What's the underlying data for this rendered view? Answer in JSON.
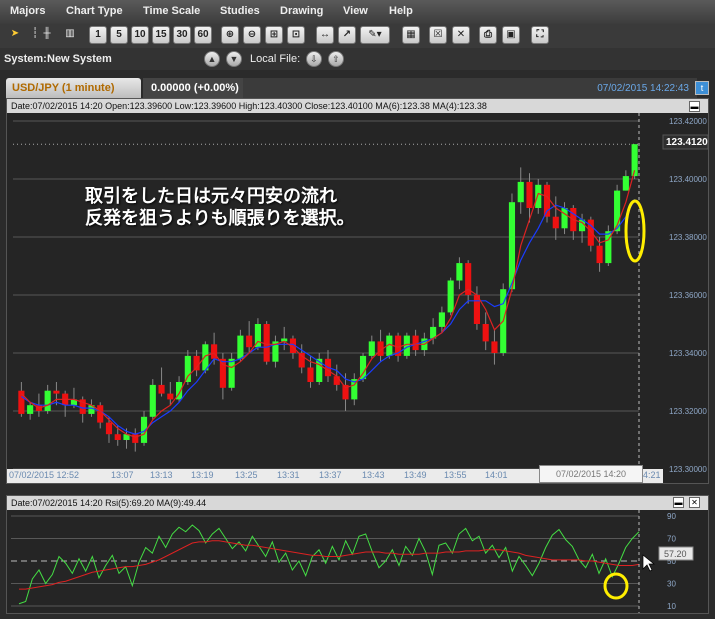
{
  "menu": [
    "Majors",
    "Chart Type",
    "Time Scale",
    "Studies",
    "Drawing",
    "View",
    "Help"
  ],
  "toolbar": {
    "intervals": [
      "1",
      "5",
      "10",
      "15",
      "30",
      "60"
    ]
  },
  "system": {
    "label": "System:",
    "name": "New System",
    "local_file_label": "Local File:"
  },
  "tab": {
    "symbol": "USD/JPY (1 minute)",
    "change": "0.00000 (+0.00%)",
    "datetime": "07/02/2015 14:22:43"
  },
  "price_panel": {
    "info": "Date:07/02/2015 14:20  Open:123.39600  Low:123.39600  High:123.40300  Close:123.40100  MA(6):123.38  MA(4):123.38",
    "last_price": "123.41200",
    "y_ticks": [
      "123.42000",
      "123.40000",
      "123.38000",
      "123.36000",
      "123.34000",
      "123.32000",
      "123.30000"
    ],
    "x_first": "07/02/2015 12:52",
    "x_ticks": [
      "13:07",
      "13:13",
      "13:19",
      "13:25",
      "13:31",
      "13:37",
      "13:43",
      "13:49",
      "13:55",
      "14:01"
    ],
    "crosshair_label": "07/02/2015 14:20",
    "x_last_partial": "4:21",
    "annotation": [
      "取引をした日は元々円安の流れ",
      "反発を狙うよりも順張りを選択。"
    ]
  },
  "rsi_panel": {
    "info": "Date:07/02/2015 14:20  Rsi(5):69.20  MA(9):49.44",
    "y_ticks": [
      "90",
      "70",
      "50",
      "30",
      "10"
    ],
    "value_label": "57.20"
  },
  "colors": {
    "up": "#33ff33",
    "down": "#ee1111",
    "ma_short": "#1a3cff",
    "ma_long": "#dd2222",
    "rsi": "#44dd44",
    "highlight": "#ffee00"
  },
  "chart_data": [
    {
      "type": "candlestick",
      "title": "USD/JPY (1 minute)",
      "ylim": [
        123.3,
        123.42
      ],
      "y_ticks": [
        123.3,
        123.32,
        123.34,
        123.36,
        123.38,
        123.4,
        123.42
      ],
      "x_tick_labels": [
        "07/02/2015 12:52",
        "13:07",
        "13:13",
        "13:19",
        "13:25",
        "13:31",
        "13:37",
        "13:43",
        "13:49",
        "13:55",
        "14:01",
        "07/02/2015 14:20"
      ],
      "candles": [
        {
          "o": 123.327,
          "h": 123.33,
          "l": 123.318,
          "c": 123.319
        },
        {
          "o": 123.319,
          "h": 123.323,
          "l": 123.317,
          "c": 123.322
        },
        {
          "o": 123.322,
          "h": 123.326,
          "l": 123.318,
          "c": 123.32
        },
        {
          "o": 123.32,
          "h": 123.329,
          "l": 123.319,
          "c": 123.327
        },
        {
          "o": 123.327,
          "h": 123.33,
          "l": 123.322,
          "c": 123.326
        },
        {
          "o": 123.326,
          "h": 123.327,
          "l": 123.318,
          "c": 123.322
        },
        {
          "o": 123.322,
          "h": 123.328,
          "l": 123.321,
          "c": 123.324
        },
        {
          "o": 123.324,
          "h": 123.325,
          "l": 123.316,
          "c": 123.319
        },
        {
          "o": 123.319,
          "h": 123.324,
          "l": 123.318,
          "c": 123.322
        },
        {
          "o": 123.322,
          "h": 123.323,
          "l": 123.314,
          "c": 123.316
        },
        {
          "o": 123.316,
          "h": 123.318,
          "l": 123.309,
          "c": 123.312
        },
        {
          "o": 123.312,
          "h": 123.315,
          "l": 123.308,
          "c": 123.31
        },
        {
          "o": 123.31,
          "h": 123.314,
          "l": 123.307,
          "c": 123.312
        },
        {
          "o": 123.312,
          "h": 123.314,
          "l": 123.306,
          "c": 123.309
        },
        {
          "o": 123.309,
          "h": 123.32,
          "l": 123.308,
          "c": 123.318
        },
        {
          "o": 123.318,
          "h": 123.331,
          "l": 123.317,
          "c": 123.329
        },
        {
          "o": 123.329,
          "h": 123.335,
          "l": 123.325,
          "c": 123.326
        },
        {
          "o": 123.326,
          "h": 123.33,
          "l": 123.322,
          "c": 123.324
        },
        {
          "o": 123.324,
          "h": 123.332,
          "l": 123.323,
          "c": 123.33
        },
        {
          "o": 123.33,
          "h": 123.341,
          "l": 123.329,
          "c": 123.339
        },
        {
          "o": 123.339,
          "h": 123.341,
          "l": 123.332,
          "c": 123.334
        },
        {
          "o": 123.334,
          "h": 123.344,
          "l": 123.333,
          "c": 123.343
        },
        {
          "o": 123.343,
          "h": 123.347,
          "l": 123.336,
          "c": 123.338
        },
        {
          "o": 123.338,
          "h": 123.34,
          "l": 123.324,
          "c": 123.328
        },
        {
          "o": 123.328,
          "h": 123.34,
          "l": 123.327,
          "c": 123.338
        },
        {
          "o": 123.338,
          "h": 123.348,
          "l": 123.337,
          "c": 123.346
        },
        {
          "o": 123.346,
          "h": 123.351,
          "l": 123.34,
          "c": 123.342
        },
        {
          "o": 123.342,
          "h": 123.352,
          "l": 123.341,
          "c": 123.35
        },
        {
          "o": 123.35,
          "h": 123.351,
          "l": 123.336,
          "c": 123.337
        },
        {
          "o": 123.337,
          "h": 123.346,
          "l": 123.335,
          "c": 123.344
        },
        {
          "o": 123.344,
          "h": 123.349,
          "l": 123.341,
          "c": 123.345
        },
        {
          "o": 123.345,
          "h": 123.346,
          "l": 123.338,
          "c": 123.34
        },
        {
          "o": 123.34,
          "h": 123.343,
          "l": 123.333,
          "c": 123.335
        },
        {
          "o": 123.335,
          "h": 123.339,
          "l": 123.328,
          "c": 123.33
        },
        {
          "o": 123.33,
          "h": 123.34,
          "l": 123.329,
          "c": 123.338
        },
        {
          "o": 123.338,
          "h": 123.341,
          "l": 123.33,
          "c": 123.332
        },
        {
          "o": 123.332,
          "h": 123.336,
          "l": 123.327,
          "c": 123.329
        },
        {
          "o": 123.329,
          "h": 123.333,
          "l": 123.32,
          "c": 123.324
        },
        {
          "o": 123.324,
          "h": 123.333,
          "l": 123.322,
          "c": 123.331
        },
        {
          "o": 123.331,
          "h": 123.34,
          "l": 123.33,
          "c": 123.339
        },
        {
          "o": 123.339,
          "h": 123.346,
          "l": 123.338,
          "c": 123.344
        },
        {
          "o": 123.344,
          "h": 123.348,
          "l": 123.337,
          "c": 123.339
        },
        {
          "o": 123.339,
          "h": 123.347,
          "l": 123.338,
          "c": 123.346
        },
        {
          "o": 123.346,
          "h": 123.347,
          "l": 123.337,
          "c": 123.339
        },
        {
          "o": 123.339,
          "h": 123.347,
          "l": 123.338,
          "c": 123.346
        },
        {
          "o": 123.346,
          "h": 123.348,
          "l": 123.339,
          "c": 123.341
        },
        {
          "o": 123.341,
          "h": 123.347,
          "l": 123.339,
          "c": 123.345
        },
        {
          "o": 123.345,
          "h": 123.352,
          "l": 123.343,
          "c": 123.349
        },
        {
          "o": 123.349,
          "h": 123.356,
          "l": 123.347,
          "c": 123.354
        },
        {
          "o": 123.354,
          "h": 123.366,
          "l": 123.353,
          "c": 123.365
        },
        {
          "o": 123.365,
          "h": 123.373,
          "l": 123.362,
          "c": 123.371
        },
        {
          "o": 123.371,
          "h": 123.372,
          "l": 123.357,
          "c": 123.36
        },
        {
          "o": 123.36,
          "h": 123.363,
          "l": 123.348,
          "c": 123.35
        },
        {
          "o": 123.35,
          "h": 123.354,
          "l": 123.341,
          "c": 123.344
        },
        {
          "o": 123.344,
          "h": 123.348,
          "l": 123.336,
          "c": 123.34
        },
        {
          "o": 123.34,
          "h": 123.364,
          "l": 123.339,
          "c": 123.362
        },
        {
          "o": 123.362,
          "h": 123.395,
          "l": 123.361,
          "c": 123.392
        },
        {
          "o": 123.392,
          "h": 123.404,
          "l": 123.388,
          "c": 123.399
        },
        {
          "o": 123.399,
          "h": 123.402,
          "l": 123.385,
          "c": 123.39
        },
        {
          "o": 123.39,
          "h": 123.4,
          "l": 123.388,
          "c": 123.398
        },
        {
          "o": 123.398,
          "h": 123.399,
          "l": 123.385,
          "c": 123.387
        },
        {
          "o": 123.387,
          "h": 123.394,
          "l": 123.379,
          "c": 123.383
        },
        {
          "o": 123.383,
          "h": 123.392,
          "l": 123.381,
          "c": 123.39
        },
        {
          "o": 123.39,
          "h": 123.391,
          "l": 123.379,
          "c": 123.382
        },
        {
          "o": 123.382,
          "h": 123.388,
          "l": 123.378,
          "c": 123.386
        },
        {
          "o": 123.386,
          "h": 123.387,
          "l": 123.375,
          "c": 123.377
        },
        {
          "o": 123.377,
          "h": 123.38,
          "l": 123.368,
          "c": 123.371
        },
        {
          "o": 123.371,
          "h": 123.384,
          "l": 123.37,
          "c": 123.382
        },
        {
          "o": 123.382,
          "h": 123.398,
          "l": 123.381,
          "c": 123.396
        },
        {
          "o": 123.396,
          "h": 123.403,
          "l": 123.396,
          "c": 123.401
        },
        {
          "o": 123.401,
          "h": 123.412,
          "l": 123.4,
          "c": 123.412
        }
      ],
      "ma": [
        {
          "name": "MA(6)",
          "values": [
            123.325,
            123.323,
            123.322,
            123.322,
            123.323,
            123.322,
            123.322,
            123.321,
            123.321,
            123.32,
            123.318,
            123.315,
            123.313,
            123.312,
            123.313,
            123.316,
            123.318,
            123.32,
            123.323,
            123.327,
            123.33,
            123.334,
            123.338,
            123.337,
            123.337,
            123.338,
            123.34,
            123.342,
            123.342,
            123.343,
            123.343,
            123.343,
            123.341,
            123.339,
            123.337,
            123.335,
            123.334,
            123.331,
            123.33,
            123.331,
            123.334,
            123.337,
            123.339,
            123.34,
            123.342,
            123.343,
            123.344,
            123.345,
            123.347,
            123.35,
            123.355,
            123.358,
            123.358,
            123.358,
            123.356,
            123.357,
            123.364,
            123.372,
            123.378,
            123.383,
            123.389,
            123.391,
            123.39,
            123.388,
            123.386,
            123.384,
            123.381,
            123.381,
            123.383,
            123.387,
            123.393
          ]
        },
        {
          "name": "MA(4)",
          "values": [
            123.326,
            123.323,
            123.321,
            123.322,
            123.324,
            123.324,
            123.324,
            123.323,
            123.322,
            123.32,
            123.317,
            123.314,
            123.312,
            123.311,
            123.312,
            123.317,
            123.32,
            123.322,
            123.326,
            123.332,
            123.335,
            123.339,
            123.34,
            123.336,
            123.335,
            123.337,
            123.34,
            123.344,
            123.343,
            123.343,
            123.344,
            123.342,
            123.339,
            123.337,
            123.336,
            123.334,
            123.332,
            123.328,
            123.329,
            123.333,
            123.338,
            123.341,
            123.343,
            123.342,
            123.343,
            123.343,
            123.343,
            123.345,
            123.347,
            123.352,
            123.36,
            123.362,
            123.36,
            123.355,
            123.348,
            123.351,
            123.362,
            123.377,
            123.386,
            123.395,
            123.394,
            123.39,
            123.388,
            123.386,
            123.385,
            123.382,
            123.378,
            123.379,
            123.384,
            123.392,
            123.403
          ]
        }
      ]
    },
    {
      "type": "line",
      "title": "Rsi(5) / MA(9)",
      "ylim": [
        10,
        90
      ],
      "y_ticks": [
        10,
        30,
        50,
        70,
        90
      ],
      "series": [
        {
          "name": "Rsi(5)",
          "values": [
            12,
            14,
            34,
            42,
            30,
            38,
            54,
            48,
            39,
            52,
            41,
            54,
            35,
            46,
            55,
            39,
            45,
            28,
            49,
            62,
            57,
            72,
            62,
            74,
            80,
            76,
            82,
            77,
            66,
            74,
            79,
            70,
            61,
            67,
            59,
            72,
            63,
            54,
            67,
            49,
            57,
            42,
            50,
            37,
            54,
            60,
            48,
            63,
            51,
            68,
            56,
            72,
            74,
            58,
            44,
            50,
            60,
            46,
            63,
            55,
            70,
            58,
            38,
            64,
            66,
            57,
            74,
            79,
            68,
            72,
            57,
            64,
            53,
            62,
            41,
            54,
            46,
            37,
            48,
            62,
            73,
            78,
            69,
            63,
            51,
            44,
            56,
            39,
            52,
            36,
            48,
            62,
            70,
            76
          ]
        },
        {
          "name": "MA(9)",
          "values": [
            25,
            25,
            26,
            27,
            28,
            29,
            31,
            32,
            34,
            36,
            38,
            40,
            41,
            42,
            43,
            44,
            45,
            45,
            46,
            47,
            49,
            51,
            54,
            57,
            60,
            63,
            66,
            67,
            67,
            68,
            68,
            67,
            66,
            65,
            64,
            64,
            63,
            62,
            61,
            60,
            59,
            58,
            57,
            56,
            55,
            55,
            54,
            54,
            54,
            55,
            56,
            57,
            58,
            58,
            58,
            57,
            57,
            56,
            56,
            56,
            56,
            57,
            57,
            57,
            58,
            58,
            58,
            59,
            59,
            59,
            60,
            60,
            60,
            59,
            58,
            57,
            55,
            54,
            53,
            52,
            51,
            51,
            51,
            51,
            51,
            50,
            50,
            49,
            48,
            47,
            46,
            46,
            46,
            47
          ]
        }
      ]
    }
  ]
}
